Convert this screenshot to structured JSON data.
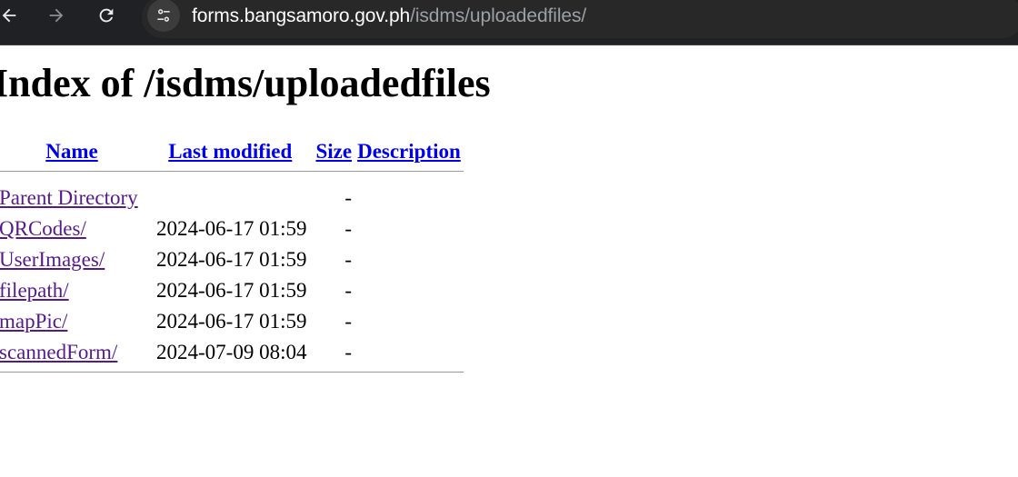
{
  "browser": {
    "url_host": "forms.bangsamoro.gov.ph",
    "url_path": "/isdms/uploadedfiles/",
    "icons": [
      "back-arrow-icon",
      "forward-arrow-icon",
      "reload-icon",
      "site-info-icon"
    ]
  },
  "page": {
    "title": "Index of /isdms/uploadedfiles",
    "headers": {
      "name": "Name",
      "last_modified": "Last modified",
      "size": "Size",
      "description": "Description"
    },
    "rows": [
      {
        "name": "Parent Directory",
        "modified": "",
        "size": "-",
        "description": ""
      },
      {
        "name": "QRCodes/",
        "modified": "2024-06-17 01:59",
        "size": "-",
        "description": ""
      },
      {
        "name": "UserImages/",
        "modified": "2024-06-17 01:59",
        "size": "-",
        "description": ""
      },
      {
        "name": "filepath/",
        "modified": "2024-06-17 01:59",
        "size": "-",
        "description": ""
      },
      {
        "name": "mapPic/",
        "modified": "2024-06-17 01:59",
        "size": "-",
        "description": ""
      },
      {
        "name": "scannedForm/",
        "modified": "2024-07-09 08:04",
        "size": "-",
        "description": ""
      }
    ]
  },
  "colors": {
    "chrome_bg": "#202124",
    "omnibox_bg": "#282828",
    "link": "#0000ee",
    "visited_link": "#551a8b"
  }
}
